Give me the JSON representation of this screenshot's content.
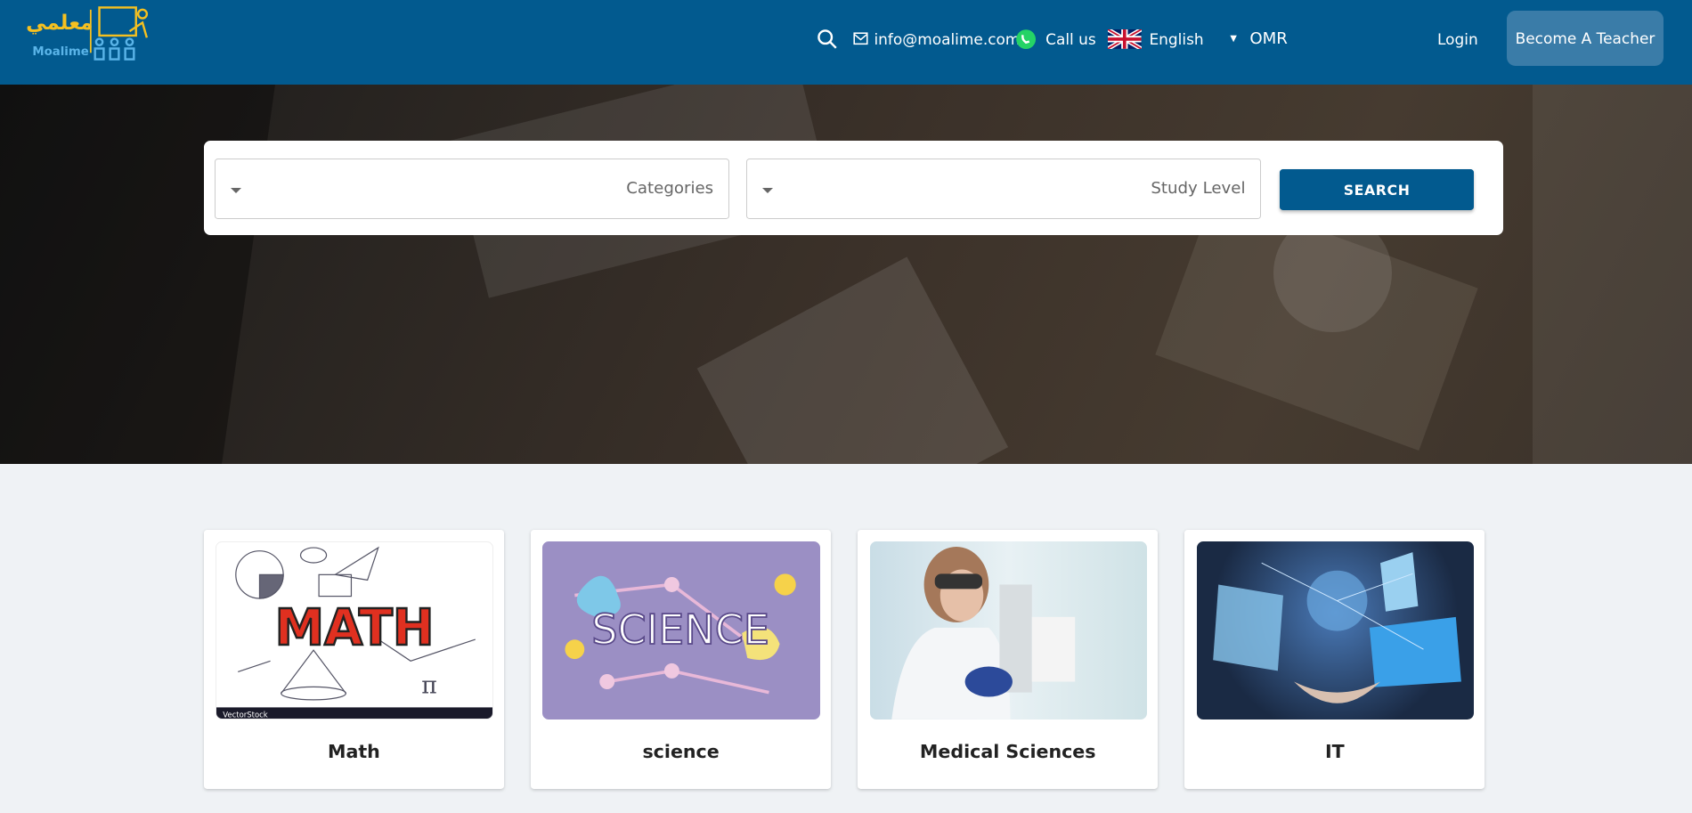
{
  "header": {
    "logo": {
      "arabic": "معلمي",
      "latin": "Moalime"
    },
    "email": "info@moalime.com",
    "call_us": "Call us",
    "language": "English",
    "currency": "OMR",
    "login": "Login",
    "become_teacher": "Become A Teacher",
    "colors": {
      "primary": "#025a8f",
      "logo_yellow": "#f5c020",
      "logo_blue": "#5ab4e8",
      "whatsapp": "#25d366"
    }
  },
  "search": {
    "categories_placeholder": "Categories",
    "study_level_placeholder": "Study Level",
    "button": "SEARCH"
  },
  "categories": [
    {
      "title": "Math",
      "image_text": "MATH",
      "image_footer": "VectorStock"
    },
    {
      "title": "science",
      "image_text": "SCIENCE"
    },
    {
      "title": "Medical Sciences"
    },
    {
      "title": "IT"
    }
  ]
}
